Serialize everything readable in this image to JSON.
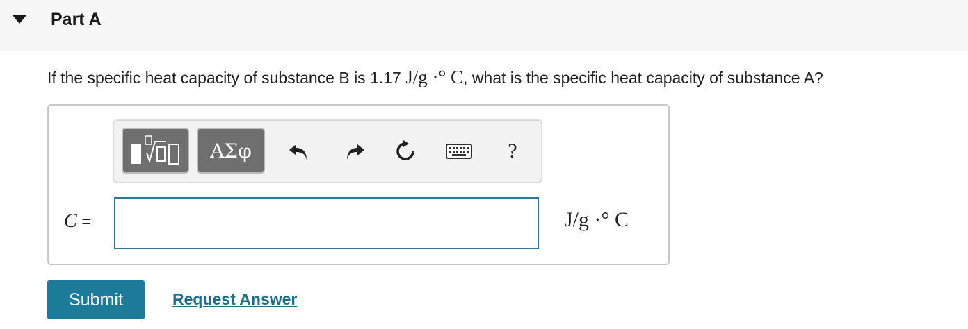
{
  "part": {
    "title": "Part A",
    "expand_icon": "caret-down-icon"
  },
  "question": {
    "prefix": "If the specific heat capacity of substance B is 1.17 ",
    "unit_math": "J/g ·° C",
    "suffix": ", what is the specific heat capacity of substance A?"
  },
  "toolbar": {
    "templates_icon": "templates-icon",
    "symbols_label": "ΑΣφ",
    "undo_icon": "undo-icon",
    "redo_icon": "redo-icon",
    "reset_icon": "reset-icon",
    "keyboard_icon": "keyboard-icon",
    "help_label": "?"
  },
  "answer": {
    "variable": "C",
    "equals": " =",
    "value": "",
    "placeholder": "",
    "unit": "J/g ·° C"
  },
  "actions": {
    "submit_label": "Submit",
    "request_answer_label": "Request Answer"
  },
  "colors": {
    "accent": "#1b7b99",
    "link": "#1b6f8c",
    "input_border": "#2b7a96",
    "toolbar_button": "#6f6f6f"
  }
}
